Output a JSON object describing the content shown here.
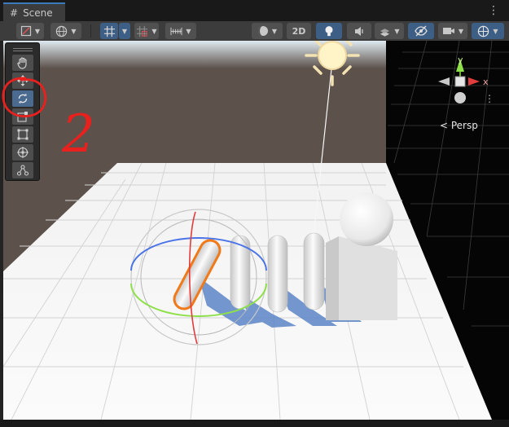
{
  "window": {
    "tab_title": "Scene",
    "tab_icon": "grid-icon",
    "menu_icon": "kebab-menu-icon"
  },
  "toolbar": {
    "draw_mode_icon": "draw-mode-icon",
    "global_icon": "globe-icon",
    "grid_snap_icon": "grid-snap-icon",
    "increment_snap_icon": "increment-snap-icon",
    "ruler_icon": "ruler-icon",
    "shading_icon": "shading-sphere-icon",
    "mode_2d_label": "2D",
    "lighting_icon": "lightbulb-icon",
    "audio_icon": "audio-icon",
    "effects_icon": "effects-icon",
    "hidden_icon": "visibility-off-icon",
    "camera_icon": "camera-icon",
    "gizmos_icon": "gizmo-globe-icon"
  },
  "tools": [
    "hand-tool-icon",
    "move-tool-icon",
    "rotate-tool-icon",
    "scale-tool-icon",
    "rect-tool-icon",
    "transform-tool-icon",
    "custom-tool-icon"
  ],
  "active_tool": "rotate",
  "gizmo": {
    "perspective_label": "< Persp",
    "y_axis": "y",
    "x_axis": "x"
  },
  "annotation": {
    "number": "2",
    "color": "#e8211e"
  },
  "colors": {
    "selected_outline": "#f07a1a",
    "x_axis": "#e23c3c",
    "y_axis": "#8ee04a",
    "z_axis": "#4a74e8",
    "toolbar_active": "#3d5f85"
  }
}
